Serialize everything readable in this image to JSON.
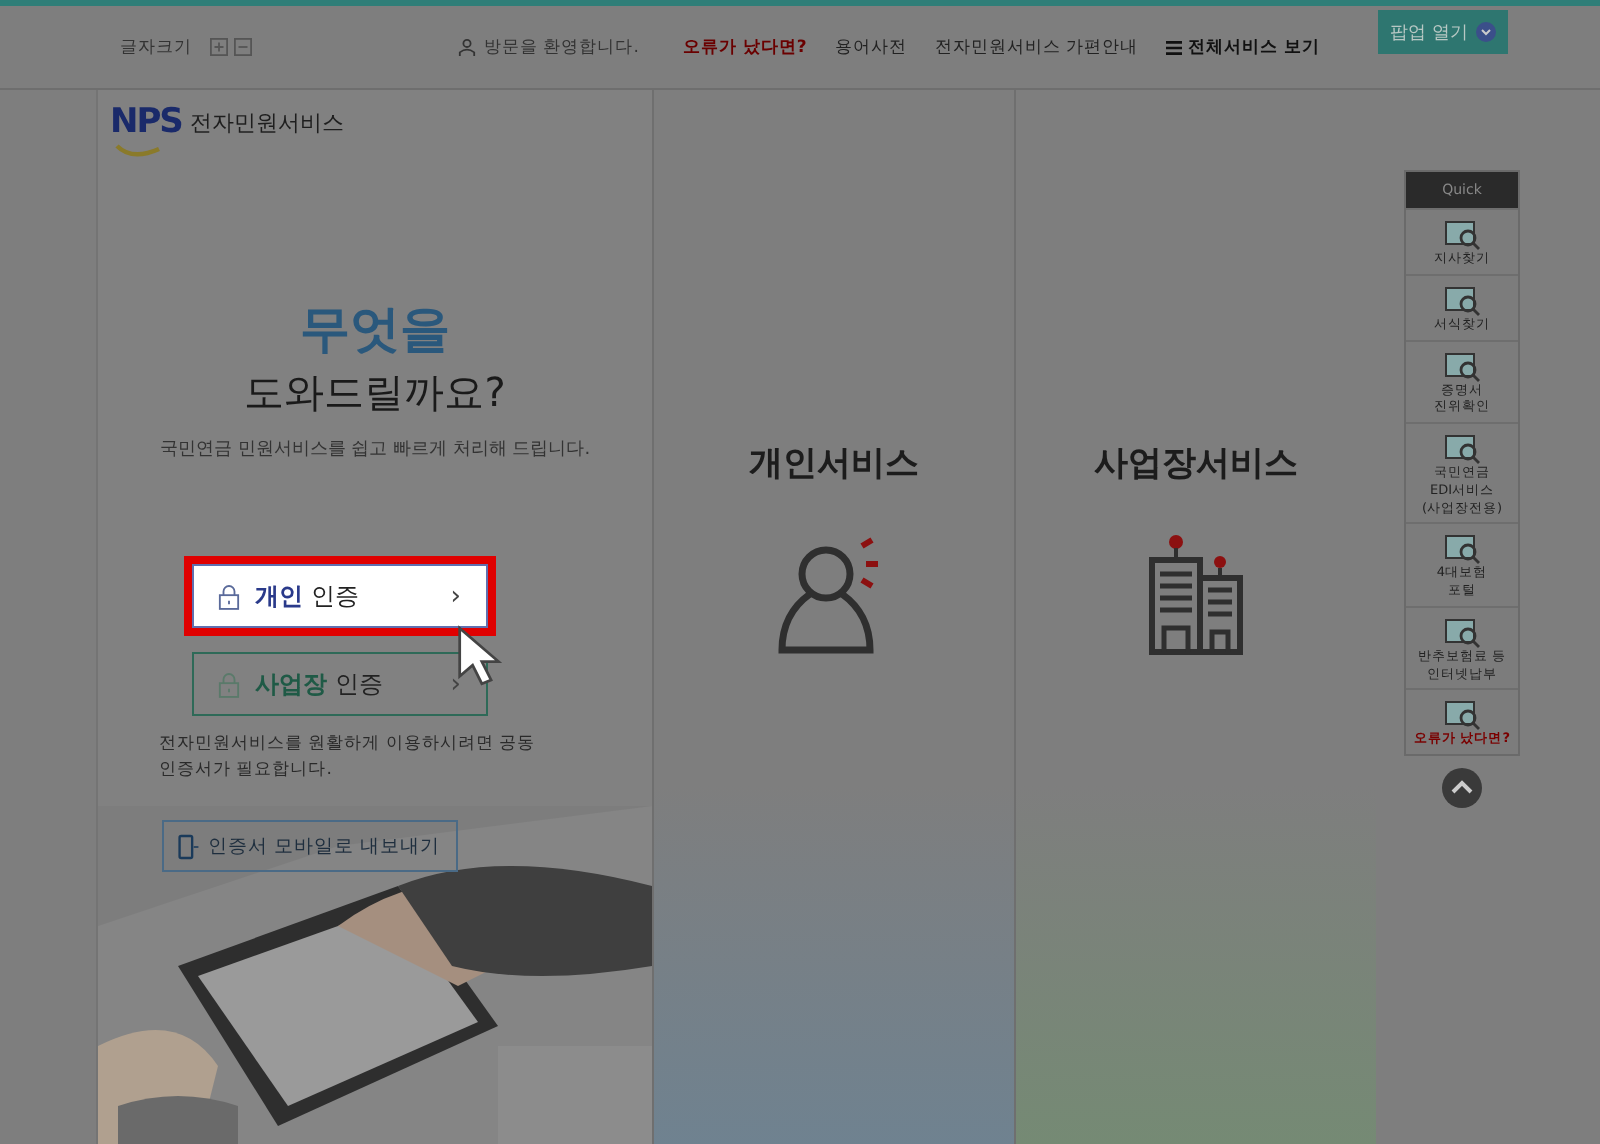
{
  "top_bar": {
    "font_size_label": "글자크기",
    "welcome": "방문을 환영합니다.",
    "links": [
      {
        "label": "오류가 났다면?",
        "kind": "alert"
      },
      {
        "label": "용어사전",
        "kind": "normal"
      },
      {
        "label": "전자민원서비스 가편안내",
        "kind": "normal"
      }
    ],
    "all_services": "전체서비스 보기",
    "popup_button": "팝업 열기"
  },
  "main": {
    "logo_mark": "NPS",
    "logo_text": "전자민원서비스",
    "heading": "무엇을",
    "subheading": "도와드릴까요?",
    "description": "국민연금 민원서비스를 쉽고 빠르게 처리해 드립니다.",
    "auth_buttons": [
      {
        "accent": "개인",
        "label": "인증",
        "arrow": "›",
        "highlighted": true,
        "kind": "person"
      },
      {
        "accent": "사업장",
        "label": "인증",
        "arrow": "›",
        "highlighted": false,
        "kind": "business"
      }
    ],
    "note": "전자민원서비스를 원활하게 이용하시려면 공동인증서가 필요합니다.",
    "export_button": "인증서 모바일로 내보내기"
  },
  "services": [
    {
      "title": "개인서비스",
      "kind": "person"
    },
    {
      "title": "사업장서비스",
      "kind": "building"
    }
  ],
  "quick": {
    "title": "Quick",
    "items": [
      {
        "lines": [
          "지사찾기"
        ],
        "kind": "normal"
      },
      {
        "lines": [
          "서식찾기"
        ],
        "kind": "normal"
      },
      {
        "lines": [
          "증명서",
          "진위확인"
        ],
        "kind": "normal"
      },
      {
        "lines": [
          "국민연금",
          "EDI서비스",
          "(사업장전용)"
        ],
        "kind": "normal"
      },
      {
        "lines": [
          "4대보험",
          "포털"
        ],
        "kind": "normal"
      },
      {
        "lines": [
          "반추보험료 등",
          "인터넷납부"
        ],
        "kind": "normal"
      },
      {
        "lines": [
          "오류가 났다면?"
        ],
        "kind": "alert"
      }
    ]
  }
}
